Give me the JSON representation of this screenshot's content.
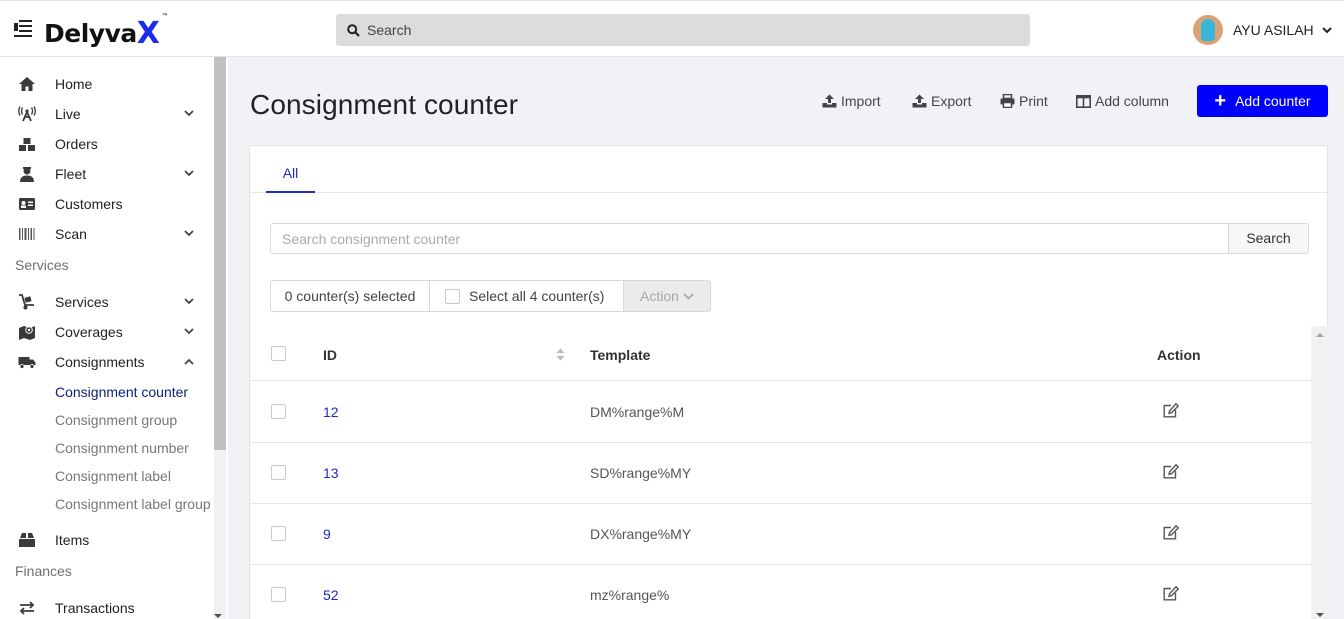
{
  "header": {
    "logo_text": "Delyva",
    "logo_x": "X",
    "logo_tm": "™",
    "search_placeholder": "Search",
    "user_name": "AYU ASILAH"
  },
  "sidebar": {
    "items": [
      {
        "label": "Home",
        "icon": "home-icon"
      },
      {
        "label": "Live",
        "icon": "broadcast-icon",
        "expandable": true
      },
      {
        "label": "Orders",
        "icon": "boxes-icon"
      },
      {
        "label": "Fleet",
        "icon": "driver-icon",
        "expandable": true
      },
      {
        "label": "Customers",
        "icon": "id-card-icon"
      },
      {
        "label": "Scan",
        "icon": "barcode-icon",
        "expandable": true
      }
    ],
    "section_services": "Services",
    "service_items": [
      {
        "label": "Services",
        "icon": "dolly-icon",
        "expandable": true
      },
      {
        "label": "Coverages",
        "icon": "map-marker-icon",
        "expandable": true
      },
      {
        "label": "Consignments",
        "icon": "truck-icon",
        "expanded": true
      }
    ],
    "consignment_sub": [
      {
        "label": "Consignment counter",
        "active": true
      },
      {
        "label": "Consignment group"
      },
      {
        "label": "Consignment number"
      },
      {
        "label": "Consignment label"
      },
      {
        "label": "Consignment label group"
      }
    ],
    "items_label": "Items",
    "section_finances": "Finances",
    "transactions_label": "Transactions"
  },
  "main": {
    "title": "Consignment counter",
    "toolbar": {
      "import": "Import",
      "export": "Export",
      "print": "Print",
      "add_column": "Add column",
      "add_counter": "Add counter"
    },
    "tabs": [
      {
        "label": "All",
        "active": true
      }
    ],
    "search_placeholder": "Search consignment counter",
    "search_button": "Search",
    "selection": {
      "count_text": "0 counter(s) selected",
      "select_all_text": "Select all 4 counter(s)",
      "action_label": "Action"
    },
    "table": {
      "columns": [
        "ID",
        "Template",
        "Action"
      ],
      "rows": [
        {
          "id": "12",
          "template": "DM%range%M"
        },
        {
          "id": "13",
          "template": "SD%range%MY"
        },
        {
          "id": "9",
          "template": "DX%range%MY"
        },
        {
          "id": "52",
          "template": "mz%range%"
        }
      ]
    }
  },
  "colors": {
    "accent": "#0000ff",
    "link": "#1a2cc0",
    "active_nav": "#0a1f7a",
    "background": "#f1f2f6"
  }
}
